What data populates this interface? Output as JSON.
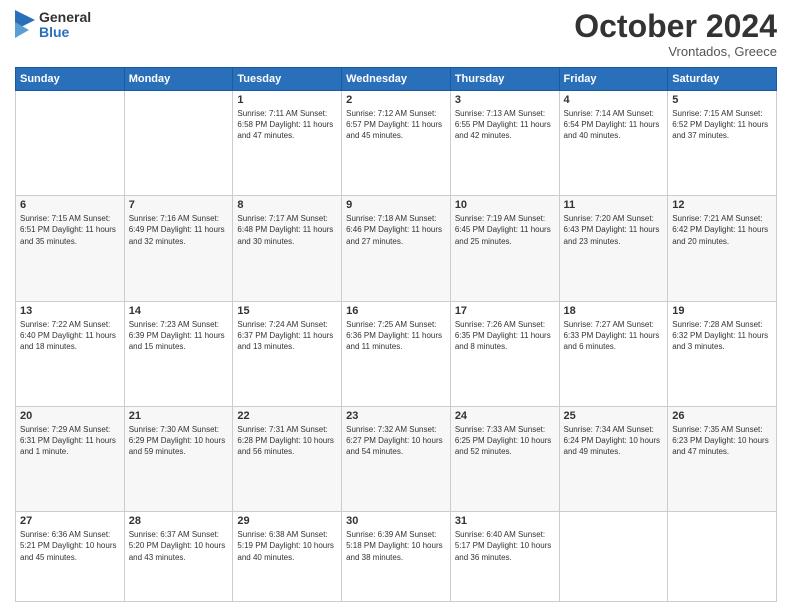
{
  "header": {
    "logo_general": "General",
    "logo_blue": "Blue",
    "month_title": "October 2024",
    "location": "Vrontados, Greece"
  },
  "days_of_week": [
    "Sunday",
    "Monday",
    "Tuesday",
    "Wednesday",
    "Thursday",
    "Friday",
    "Saturday"
  ],
  "weeks": [
    [
      {
        "day": "",
        "info": ""
      },
      {
        "day": "",
        "info": ""
      },
      {
        "day": "1",
        "info": "Sunrise: 7:11 AM\nSunset: 6:58 PM\nDaylight: 11 hours and 47 minutes."
      },
      {
        "day": "2",
        "info": "Sunrise: 7:12 AM\nSunset: 6:57 PM\nDaylight: 11 hours and 45 minutes."
      },
      {
        "day": "3",
        "info": "Sunrise: 7:13 AM\nSunset: 6:55 PM\nDaylight: 11 hours and 42 minutes."
      },
      {
        "day": "4",
        "info": "Sunrise: 7:14 AM\nSunset: 6:54 PM\nDaylight: 11 hours and 40 minutes."
      },
      {
        "day": "5",
        "info": "Sunrise: 7:15 AM\nSunset: 6:52 PM\nDaylight: 11 hours and 37 minutes."
      }
    ],
    [
      {
        "day": "6",
        "info": "Sunrise: 7:15 AM\nSunset: 6:51 PM\nDaylight: 11 hours and 35 minutes."
      },
      {
        "day": "7",
        "info": "Sunrise: 7:16 AM\nSunset: 6:49 PM\nDaylight: 11 hours and 32 minutes."
      },
      {
        "day": "8",
        "info": "Sunrise: 7:17 AM\nSunset: 6:48 PM\nDaylight: 11 hours and 30 minutes."
      },
      {
        "day": "9",
        "info": "Sunrise: 7:18 AM\nSunset: 6:46 PM\nDaylight: 11 hours and 27 minutes."
      },
      {
        "day": "10",
        "info": "Sunrise: 7:19 AM\nSunset: 6:45 PM\nDaylight: 11 hours and 25 minutes."
      },
      {
        "day": "11",
        "info": "Sunrise: 7:20 AM\nSunset: 6:43 PM\nDaylight: 11 hours and 23 minutes."
      },
      {
        "day": "12",
        "info": "Sunrise: 7:21 AM\nSunset: 6:42 PM\nDaylight: 11 hours and 20 minutes."
      }
    ],
    [
      {
        "day": "13",
        "info": "Sunrise: 7:22 AM\nSunset: 6:40 PM\nDaylight: 11 hours and 18 minutes."
      },
      {
        "day": "14",
        "info": "Sunrise: 7:23 AM\nSunset: 6:39 PM\nDaylight: 11 hours and 15 minutes."
      },
      {
        "day": "15",
        "info": "Sunrise: 7:24 AM\nSunset: 6:37 PM\nDaylight: 11 hours and 13 minutes."
      },
      {
        "day": "16",
        "info": "Sunrise: 7:25 AM\nSunset: 6:36 PM\nDaylight: 11 hours and 11 minutes."
      },
      {
        "day": "17",
        "info": "Sunrise: 7:26 AM\nSunset: 6:35 PM\nDaylight: 11 hours and 8 minutes."
      },
      {
        "day": "18",
        "info": "Sunrise: 7:27 AM\nSunset: 6:33 PM\nDaylight: 11 hours and 6 minutes."
      },
      {
        "day": "19",
        "info": "Sunrise: 7:28 AM\nSunset: 6:32 PM\nDaylight: 11 hours and 3 minutes."
      }
    ],
    [
      {
        "day": "20",
        "info": "Sunrise: 7:29 AM\nSunset: 6:31 PM\nDaylight: 11 hours and 1 minute."
      },
      {
        "day": "21",
        "info": "Sunrise: 7:30 AM\nSunset: 6:29 PM\nDaylight: 10 hours and 59 minutes."
      },
      {
        "day": "22",
        "info": "Sunrise: 7:31 AM\nSunset: 6:28 PM\nDaylight: 10 hours and 56 minutes."
      },
      {
        "day": "23",
        "info": "Sunrise: 7:32 AM\nSunset: 6:27 PM\nDaylight: 10 hours and 54 minutes."
      },
      {
        "day": "24",
        "info": "Sunrise: 7:33 AM\nSunset: 6:25 PM\nDaylight: 10 hours and 52 minutes."
      },
      {
        "day": "25",
        "info": "Sunrise: 7:34 AM\nSunset: 6:24 PM\nDaylight: 10 hours and 49 minutes."
      },
      {
        "day": "26",
        "info": "Sunrise: 7:35 AM\nSunset: 6:23 PM\nDaylight: 10 hours and 47 minutes."
      }
    ],
    [
      {
        "day": "27",
        "info": "Sunrise: 6:36 AM\nSunset: 5:21 PM\nDaylight: 10 hours and 45 minutes."
      },
      {
        "day": "28",
        "info": "Sunrise: 6:37 AM\nSunset: 5:20 PM\nDaylight: 10 hours and 43 minutes."
      },
      {
        "day": "29",
        "info": "Sunrise: 6:38 AM\nSunset: 5:19 PM\nDaylight: 10 hours and 40 minutes."
      },
      {
        "day": "30",
        "info": "Sunrise: 6:39 AM\nSunset: 5:18 PM\nDaylight: 10 hours and 38 minutes."
      },
      {
        "day": "31",
        "info": "Sunrise: 6:40 AM\nSunset: 5:17 PM\nDaylight: 10 hours and 36 minutes."
      },
      {
        "day": "",
        "info": ""
      },
      {
        "day": "",
        "info": ""
      }
    ]
  ]
}
